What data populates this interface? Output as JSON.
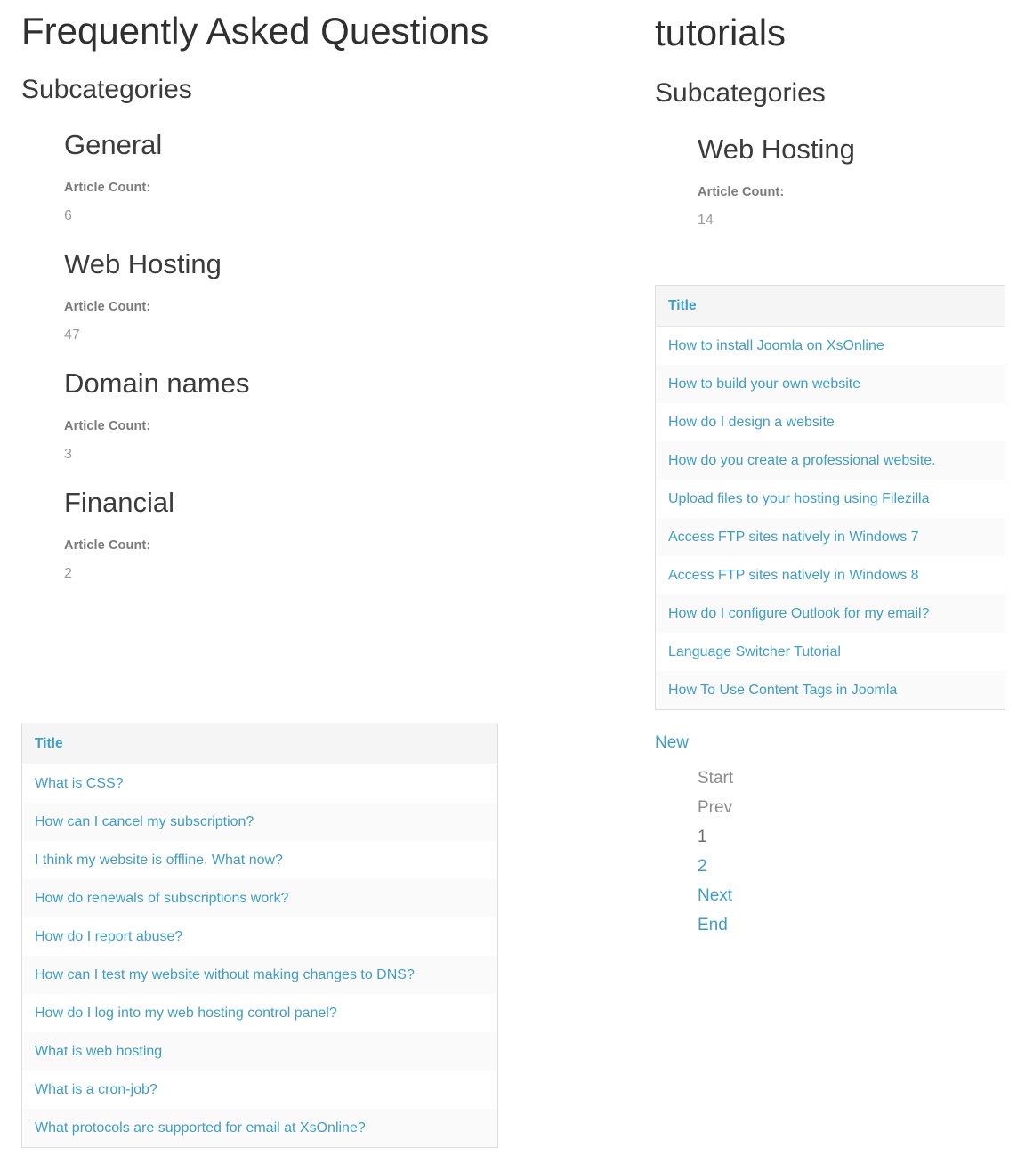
{
  "left_column": {
    "category_title": "Frequently Asked Questions",
    "subcategories_heading": "Subcategories",
    "article_count_label": "Article Count:",
    "subcategories": [
      {
        "name": "General",
        "article_count": "6"
      },
      {
        "name": "Web Hosting",
        "article_count": "47"
      },
      {
        "name": "Domain names",
        "article_count": "3"
      },
      {
        "name": "Financial",
        "article_count": "2"
      }
    ],
    "table": {
      "column_header": "Title",
      "rows": [
        {
          "title": "What is CSS?"
        },
        {
          "title": "How can I cancel my subscription?"
        },
        {
          "title": "I think my website is offline. What now?"
        },
        {
          "title": "How do renewals of subscriptions work?"
        },
        {
          "title": "How do I report abuse?"
        },
        {
          "title": "How can I test my website without making changes to DNS?"
        },
        {
          "title": "How do I log into my web hosting control panel?"
        },
        {
          "title": "What is web hosting"
        },
        {
          "title": "What is a cron-job?"
        },
        {
          "title": "What protocols are supported for email at XsOnline?"
        }
      ]
    }
  },
  "right_column": {
    "category_title": "tutorials",
    "subcategories_heading": "Subcategories",
    "article_count_label": "Article Count:",
    "subcategories": [
      {
        "name": "Web Hosting",
        "article_count": "14"
      }
    ],
    "table": {
      "column_header": "Title",
      "rows": [
        {
          "title": "How to install Joomla on XsOnline"
        },
        {
          "title": "How to build your own website"
        },
        {
          "title": "How do I design a website"
        },
        {
          "title": "How do you create a professional website."
        },
        {
          "title": "Upload files to your hosting using Filezilla"
        },
        {
          "title": "Access FTP sites natively in Windows 7"
        },
        {
          "title": "Access FTP sites natively in Windows 8"
        },
        {
          "title": "How do I configure Outlook for my email?"
        },
        {
          "title": "Language Switcher Tutorial"
        },
        {
          "title": "How To Use Content Tags in Joomla"
        }
      ]
    },
    "new_link": "New",
    "pagination": [
      {
        "label": "Start",
        "state": "disabled"
      },
      {
        "label": "Prev",
        "state": "disabled"
      },
      {
        "label": "1",
        "state": "active"
      },
      {
        "label": "2",
        "state": "link"
      },
      {
        "label": "Next",
        "state": "link"
      },
      {
        "label": "End",
        "state": "link"
      }
    ]
  },
  "colors": {
    "link": "#3f9ec6",
    "heading": "#3b3b3b",
    "muted": "#8c8c8c",
    "table_header_bg": "#f5f5f5",
    "table_border": "#dddddd",
    "row_alt_bg": "#fafafa"
  }
}
